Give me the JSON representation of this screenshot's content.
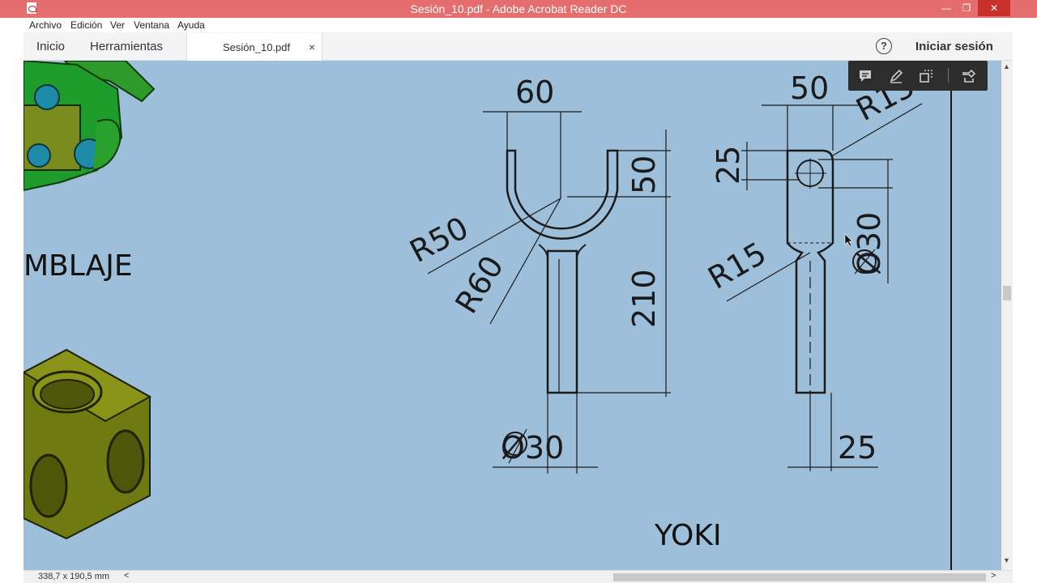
{
  "window": {
    "title": "Sesión_10.pdf - Adobe Acrobat Reader DC",
    "minimize": "—",
    "maximize": "❐",
    "close": "✕"
  },
  "menu": {
    "items": [
      "Archivo",
      "Edición",
      "Ver",
      "Ventana",
      "Ayuda"
    ]
  },
  "tabs": {
    "home": "Inicio",
    "tools": "Herramientas",
    "document": "Sesión_10.pdf",
    "close": "×"
  },
  "header": {
    "help": "?",
    "signin": "Iniciar sesión"
  },
  "drawing": {
    "partial_heading": "MBLAJE",
    "title": "YOKI",
    "front_view": {
      "width": "60",
      "slot_depth": "50",
      "inner_radius": "R50",
      "outer_radius": "R60",
      "shaft_length": "210",
      "shaft_diameter": "Ø30"
    },
    "side_view": {
      "width": "50",
      "top_radius": "R15",
      "hole_offset": "25",
      "hole_diameter": "Ø30",
      "fillet_radius": "R15",
      "shaft_width": "25"
    }
  },
  "status": {
    "page_size": "338,7 x 190,5 mm",
    "scroll_left": "<",
    "scroll_right": ">"
  },
  "scroll": {
    "up": "▲",
    "down": "▼"
  }
}
